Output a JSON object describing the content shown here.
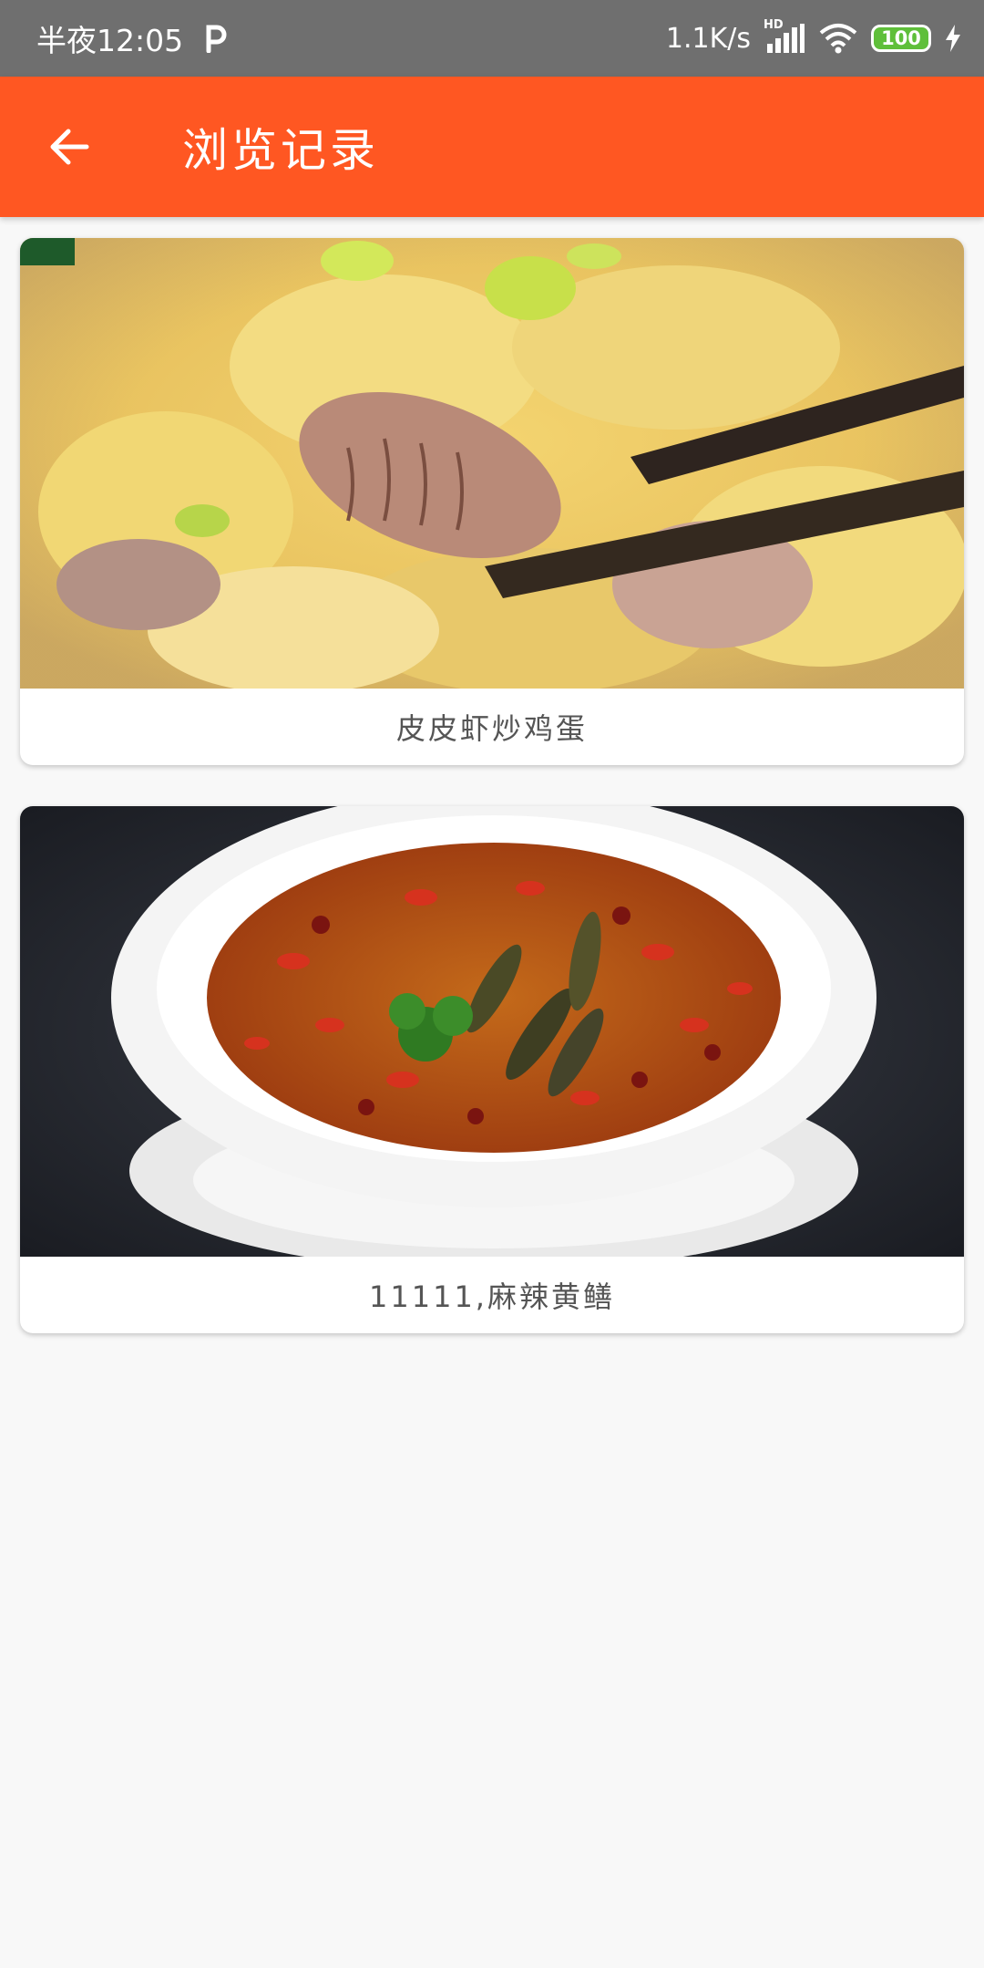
{
  "status_bar": {
    "time": "半夜12:05",
    "network_speed": "1.1K/s",
    "hd_label": "HD",
    "battery_level": "100",
    "icons": [
      "p-app-icon",
      "signal-icon",
      "wifi-icon",
      "battery-icon",
      "charging-icon"
    ]
  },
  "app_bar": {
    "title": "浏览记录",
    "back_icon": "arrow-back-icon",
    "color": "#ff5722"
  },
  "history": {
    "items": [
      {
        "title": "皮皮虾炒鸡蛋",
        "image": "stir-fried-mantis-shrimp-with-egg-photo"
      },
      {
        "title": "11111,麻辣黄鳝",
        "image": "spicy-eel-with-chili-photo"
      }
    ]
  }
}
